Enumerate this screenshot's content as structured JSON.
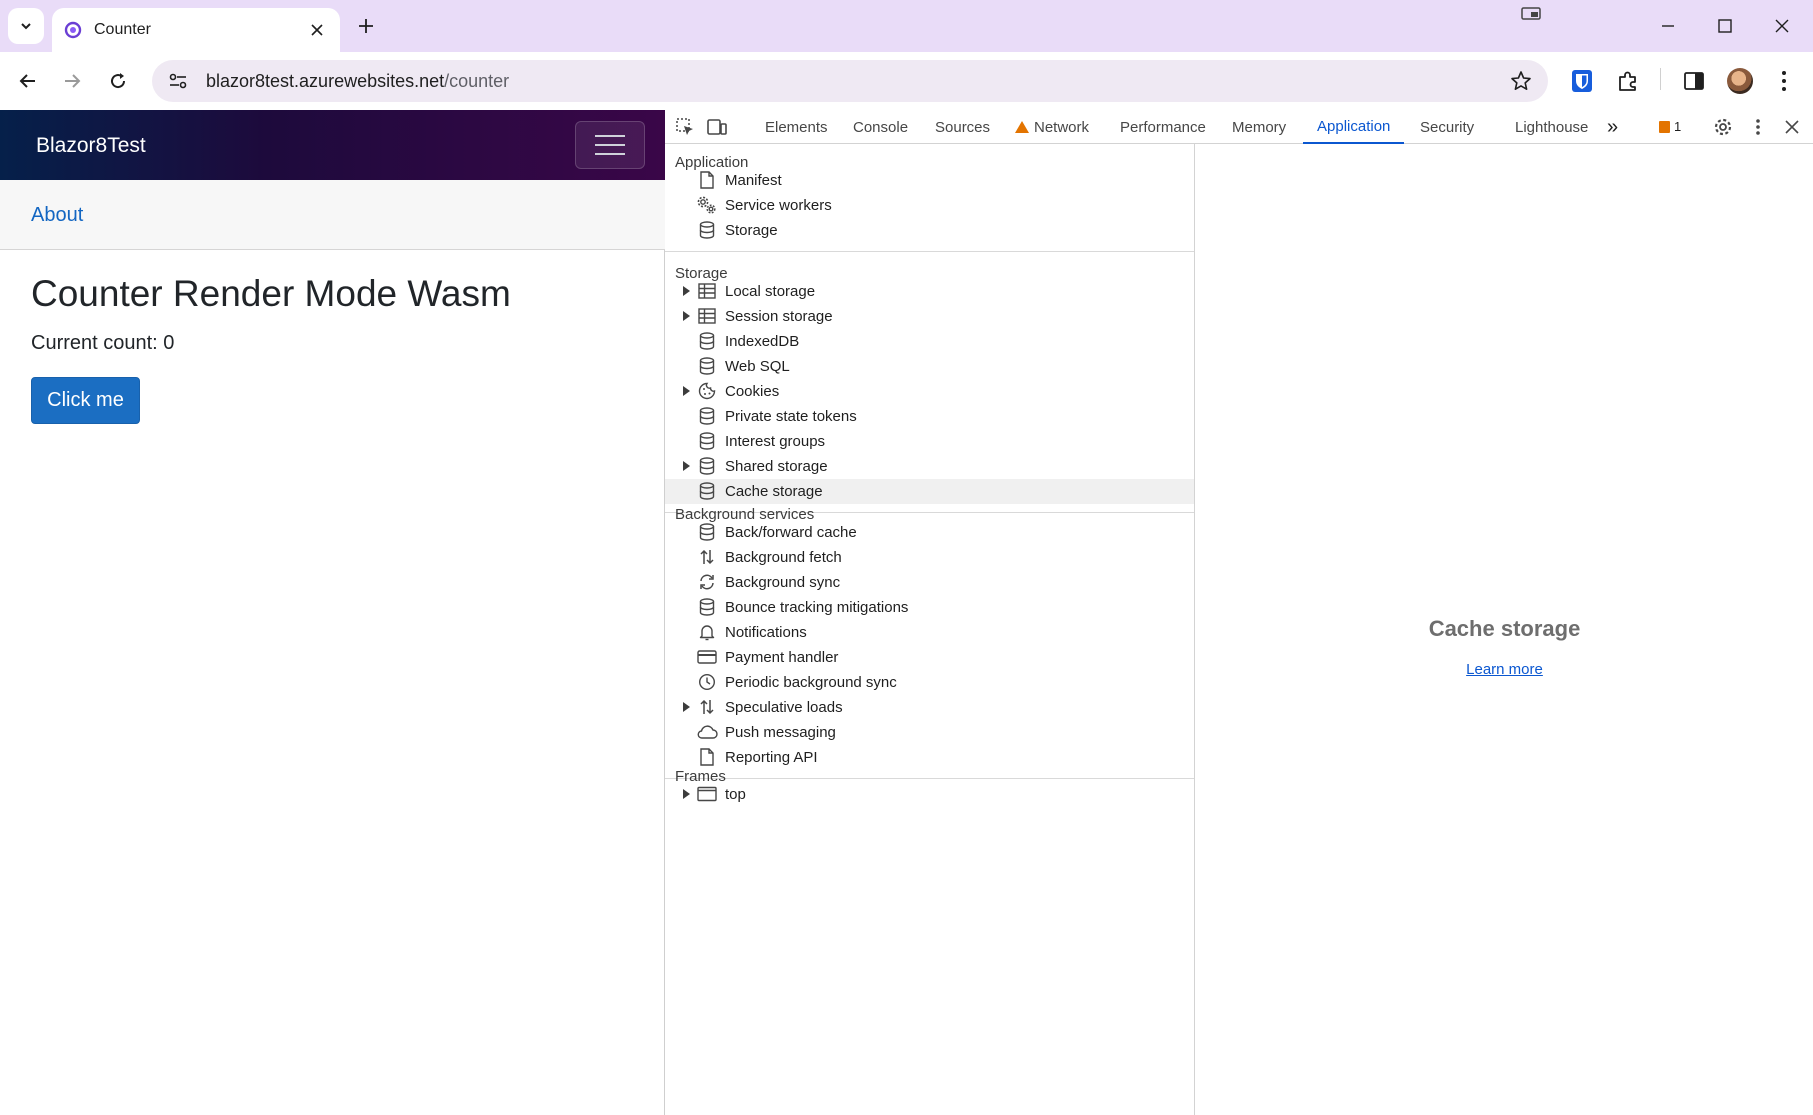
{
  "browser": {
    "tab_title": "Counter",
    "url_host": "blazor8test.azurewebsites.net",
    "url_path": "/counter"
  },
  "app": {
    "brand": "Blazor8Test",
    "about_link": "About",
    "heading": "Counter Render Mode Wasm",
    "current_count": "Current count: 0",
    "click_button": "Click me",
    "header_gradient": [
      "#05204a",
      "#3a0648"
    ],
    "button_color": "#1b6ec2"
  },
  "devtools": {
    "tabs": [
      "Elements",
      "Console",
      "Sources",
      "Network",
      "Performance",
      "Memory",
      "Application",
      "Security",
      "Lighthouse"
    ],
    "active_tab": "Application",
    "more_tabs": "»",
    "issues_count": "1",
    "sections": {
      "application": {
        "title": "Application",
        "items": [
          {
            "label": "Manifest",
            "icon": "file-icon"
          },
          {
            "label": "Service workers",
            "icon": "gears-icon"
          },
          {
            "label": "Storage",
            "icon": "database-icon"
          }
        ]
      },
      "storage": {
        "title": "Storage",
        "items": [
          {
            "label": "Local storage",
            "icon": "table-icon",
            "expandable": true
          },
          {
            "label": "Session storage",
            "icon": "table-icon",
            "expandable": true
          },
          {
            "label": "IndexedDB",
            "icon": "database-icon"
          },
          {
            "label": "Web SQL",
            "icon": "database-icon"
          },
          {
            "label": "Cookies",
            "icon": "cookie-icon",
            "expandable": true
          },
          {
            "label": "Private state tokens",
            "icon": "database-icon"
          },
          {
            "label": "Interest groups",
            "icon": "database-icon"
          },
          {
            "label": "Shared storage",
            "icon": "database-icon",
            "expandable": true
          },
          {
            "label": "Cache storage",
            "icon": "database-icon",
            "selected": true
          }
        ]
      },
      "background": {
        "title": "Background services",
        "items": [
          {
            "label": "Back/forward cache",
            "icon": "database-icon"
          },
          {
            "label": "Background fetch",
            "icon": "up-down-arrows-icon"
          },
          {
            "label": "Background sync",
            "icon": "sync-icon"
          },
          {
            "label": "Bounce tracking mitigations",
            "icon": "database-icon"
          },
          {
            "label": "Notifications",
            "icon": "bell-icon"
          },
          {
            "label": "Payment handler",
            "icon": "credit-card-icon"
          },
          {
            "label": "Periodic background sync",
            "icon": "clock-icon"
          },
          {
            "label": "Speculative loads",
            "icon": "up-down-arrows-icon",
            "expandable": true
          },
          {
            "label": "Push messaging",
            "icon": "cloud-icon"
          },
          {
            "label": "Reporting API",
            "icon": "file-icon"
          }
        ]
      },
      "frames": {
        "title": "Frames",
        "items": [
          {
            "label": "top",
            "icon": "frame-icon",
            "expandable": true
          }
        ]
      }
    },
    "main": {
      "title": "Cache storage",
      "link": "Learn more"
    }
  }
}
